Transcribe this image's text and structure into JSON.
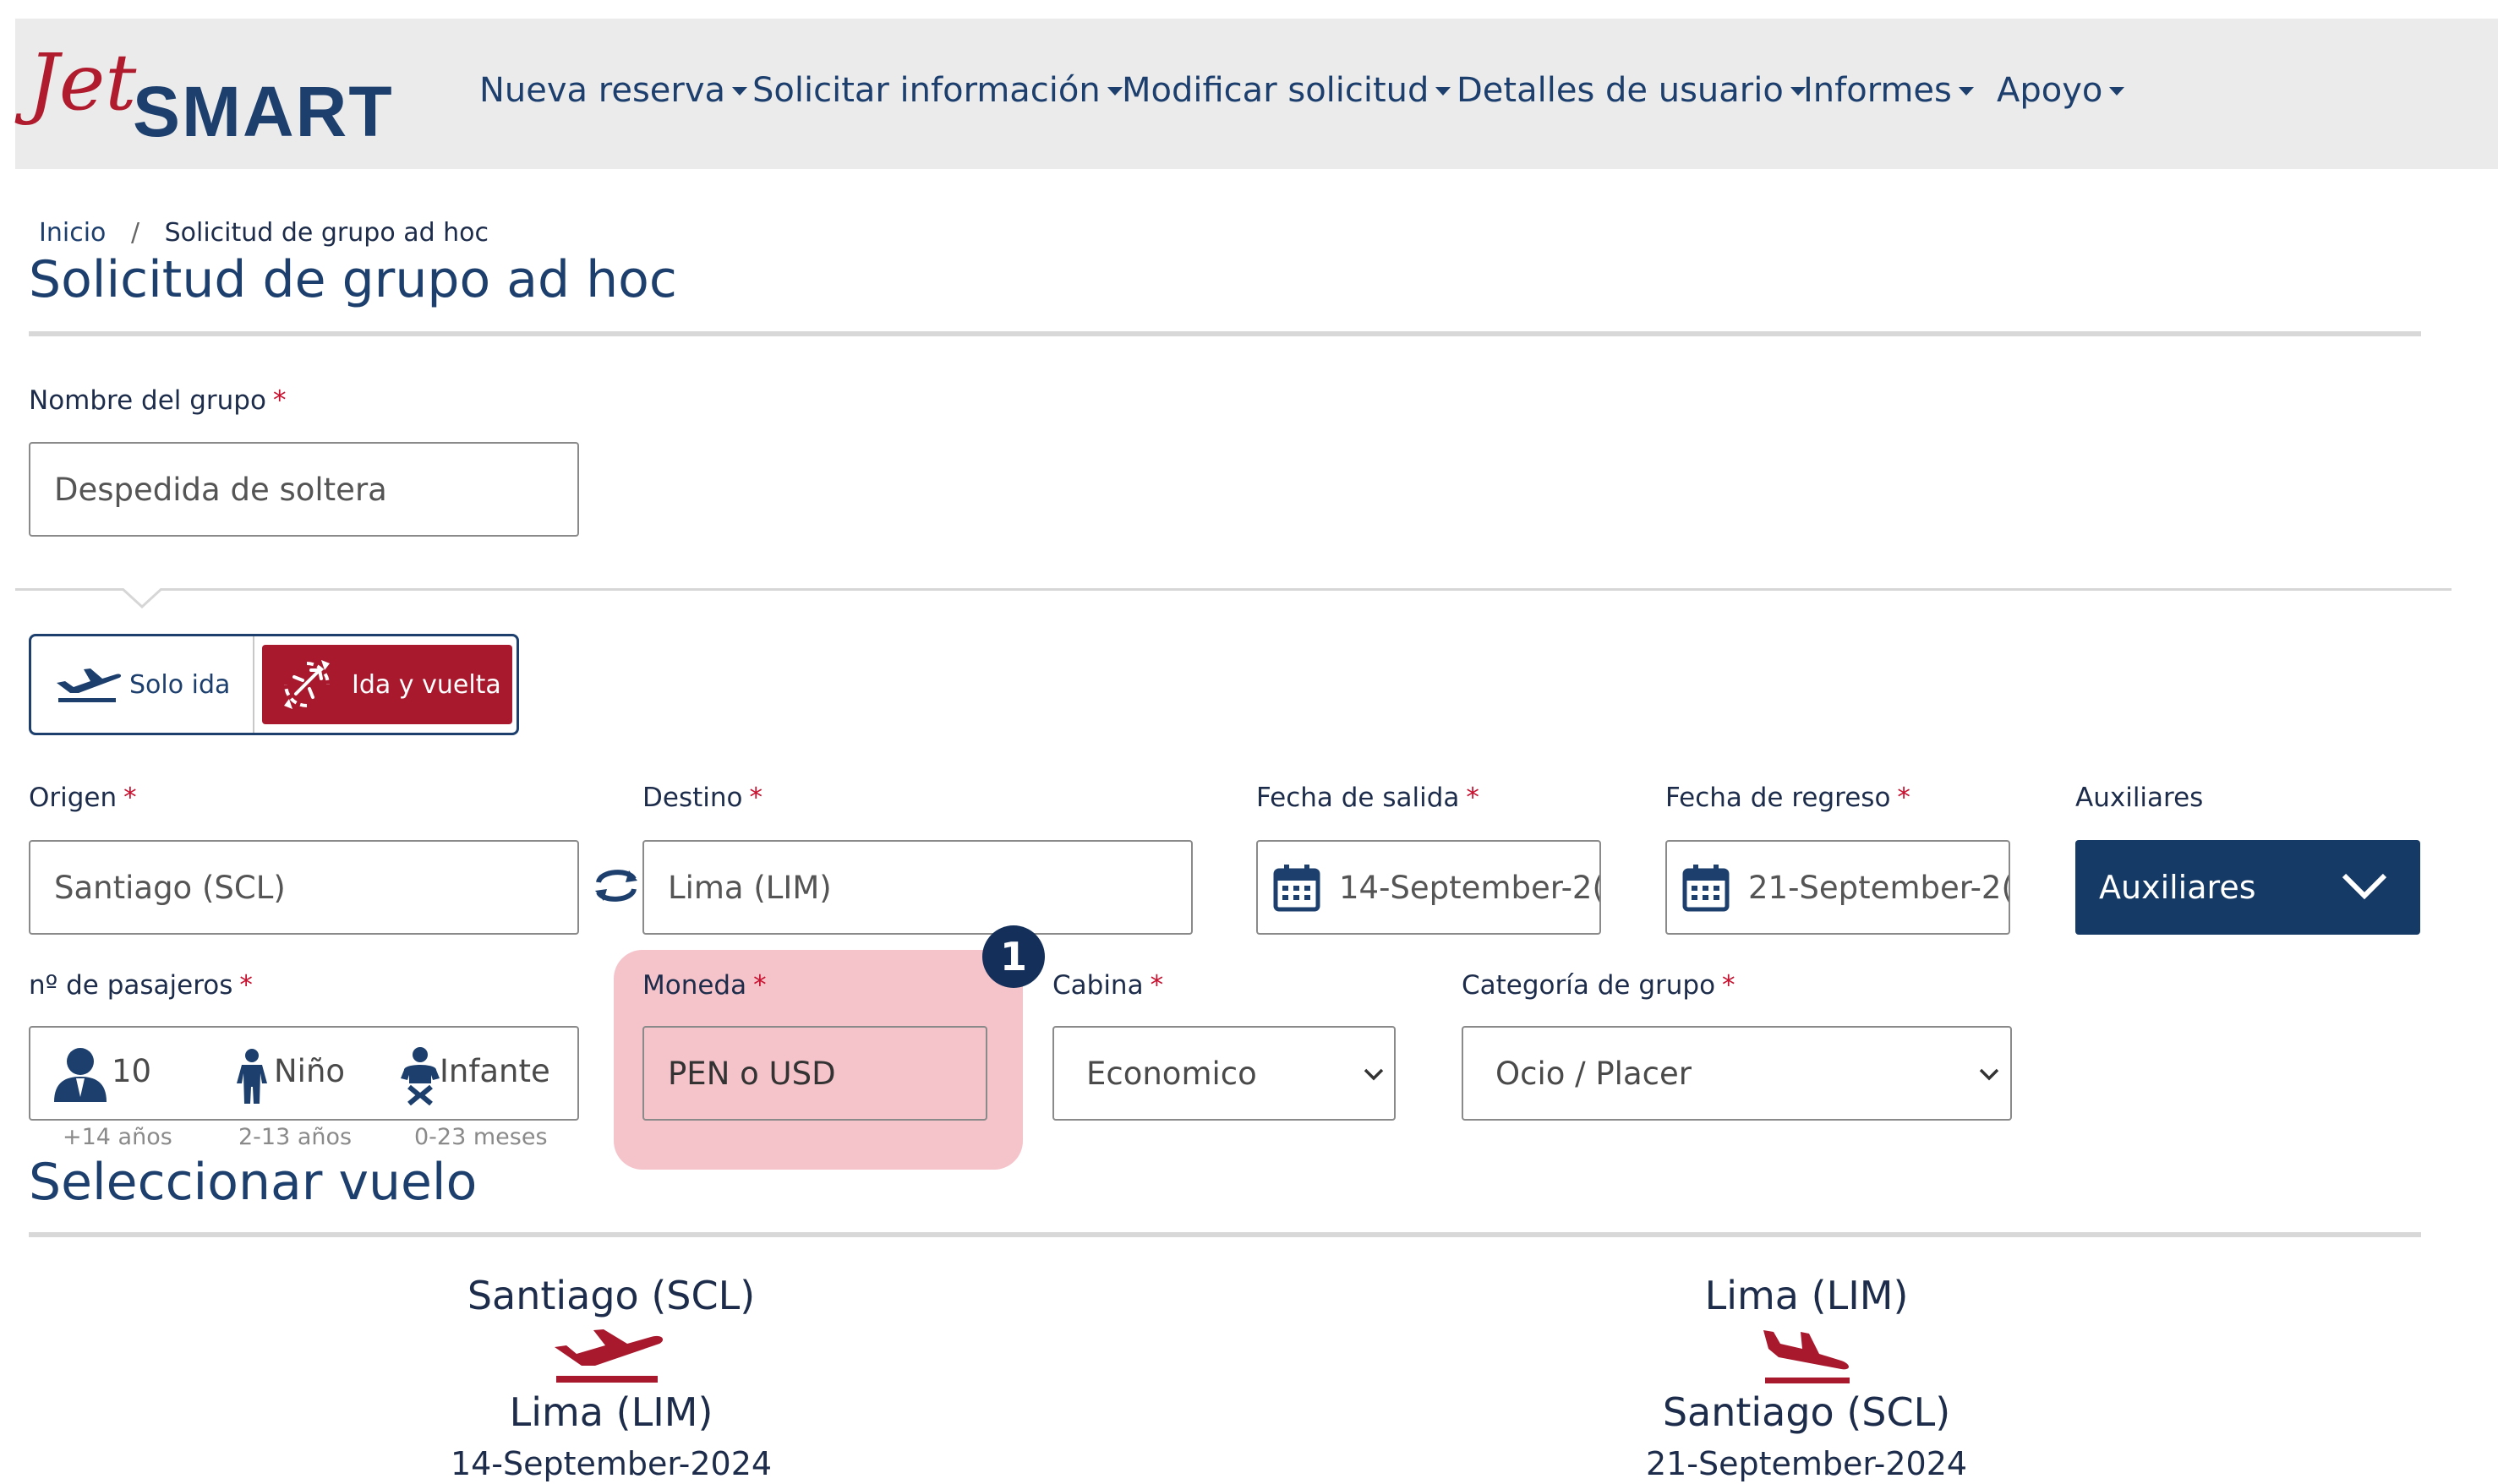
{
  "brand": {
    "logo_text_jet": "Jet",
    "logo_text_smart": "SMART",
    "primary": "#1d3f6e",
    "accent": "#a8192e"
  },
  "nav": {
    "items": [
      {
        "label": "Nueva reserva"
      },
      {
        "label": "Solicitar información"
      },
      {
        "label": "Modificar solicitud"
      },
      {
        "label": "Detalles de usuario"
      },
      {
        "label": "Informes"
      },
      {
        "label": "Apoyo"
      }
    ]
  },
  "breadcrumb": {
    "home": "Inicio",
    "separator": "/",
    "current": "Solicitud de grupo ad hoc"
  },
  "page_title": "Solicitud de grupo ad hoc",
  "form": {
    "required_mark": "*",
    "group_name": {
      "label": "Nombre del grupo",
      "value": "Despedida de soltera"
    },
    "trip_type": {
      "one_way": "Solo ida",
      "round_trip": "Ida y vuelta",
      "selected": "Ida y vuelta"
    },
    "origin": {
      "label": "Origen",
      "value": "Santiago (SCL)"
    },
    "destination": {
      "label": "Destino",
      "value": "Lima (LIM)"
    },
    "departure_date": {
      "label": "Fecha de salida",
      "value": "14-September-2("
    },
    "return_date": {
      "label": "Fecha de regreso",
      "value": "21-September-2("
    },
    "ancillaries": {
      "label": "Auxiliares",
      "button": "Auxiliares"
    },
    "passengers": {
      "label": "nº de pasajeros",
      "adults_value": "10",
      "child_label": "Niño",
      "infant_label": "Infante",
      "adults_hint": "+14 años",
      "child_hint": "2-13 años",
      "infant_hint": "0-23 meses"
    },
    "currency": {
      "label": "Moneda",
      "value": "PEN o USD"
    },
    "cabin": {
      "label": "Cabina",
      "value": "Economico"
    },
    "group_category": {
      "label": "Categoría de grupo",
      "value": "Ocio / Placer"
    }
  },
  "callout": {
    "number": "1",
    "color": "#f3b8c1"
  },
  "select_flight": {
    "title": "Seleccionar vuelo",
    "outbound": {
      "from": "Santiago (SCL)",
      "to": "Lima (LIM)",
      "date": "14-September-2024"
    },
    "inbound": {
      "from": "Lima (LIM)",
      "to": "Santiago (SCL)",
      "date": "21-September-2024"
    }
  }
}
